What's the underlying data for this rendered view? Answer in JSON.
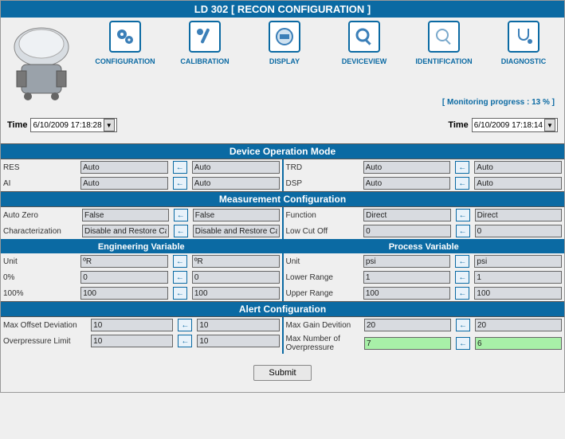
{
  "title": "LD 302 [ RECON CONFIGURATION ]",
  "nav": {
    "configuration": "CONFIGURATION",
    "calibration": "CALIBRATION",
    "display": "DISPLAY",
    "deviceview": "DEVICEVIEW",
    "identification": "IDENTIFICATION",
    "diagnostic": "DIAGNOSTIC"
  },
  "monitor_text": "[ Monitoring progress : 13 % ]",
  "time_label": "Time",
  "time_left": "6/10/2009 17:18:28",
  "time_right": "6/10/2009 17:18:14",
  "sections": {
    "dom": "Device Operation Mode",
    "mc": "Measurement Configuration",
    "ev": "Engineering Variable",
    "pv": "Process Variable",
    "ac": "Alert Configuration"
  },
  "dom": {
    "res_lbl": "RES",
    "res_a": "Auto",
    "res_b": "Auto",
    "ai_lbl": "AI",
    "ai_a": "Auto",
    "ai_b": "Auto",
    "trd_lbl": "TRD",
    "trd_a": "Auto",
    "trd_b": "Auto",
    "dsp_lbl": "DSP",
    "dsp_a": "Auto",
    "dsp_b": "Auto"
  },
  "mc": {
    "az_lbl": "Auto Zero",
    "az_a": "False",
    "az_b": "False",
    "ch_lbl": "Characterization",
    "ch_a": "Disable and Restore Cal",
    "ch_b": "Disable and Restore Cal",
    "fn_lbl": "Function",
    "fn_a": "Direct",
    "fn_b": "Direct",
    "lc_lbl": "Low Cut Off",
    "lc_a": "0",
    "lc_b": "0"
  },
  "ev": {
    "unit_lbl": "Unit",
    "unit_a": "ºR",
    "unit_b": "ºR",
    "p0_lbl": "0%",
    "p0_a": "0",
    "p0_b": "0",
    "p100_lbl": "100%",
    "p100_a": "100",
    "p100_b": "100"
  },
  "pv": {
    "unit_lbl": "Unit",
    "unit_a": "psi",
    "unit_b": "psi",
    "lr_lbl": "Lower Range",
    "lr_a": "1",
    "lr_b": "1",
    "ur_lbl": "Upper Range",
    "ur_a": "100",
    "ur_b": "100"
  },
  "ac": {
    "mod_lbl": "Max Offset Deviation",
    "mod_a": "10",
    "mod_b": "10",
    "opl_lbl": "Overpressure Limit",
    "opl_a": "10",
    "opl_b": "10",
    "mgd_lbl": "Max Gain Devition",
    "mgd_a": "20",
    "mgd_b": "20",
    "mno_lbl": "Max Number of Overpressure",
    "mno_a": "7",
    "mno_b": "6"
  },
  "submit": "Submit"
}
